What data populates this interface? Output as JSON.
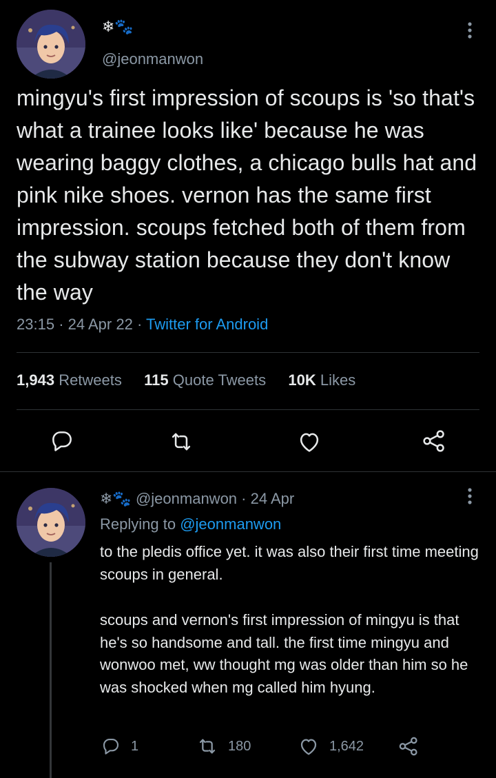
{
  "tweet": {
    "author_emoji": "❄🐾",
    "handle": "@jeonmanwon",
    "text": "mingyu's first impression of scoups is 'so that's what a trainee looks like' because he was wearing baggy clothes, a chicago bulls hat and pink nike shoes. vernon has the same first impression. scoups fetched both of them from the subway station because they don't know the way",
    "time": "23:15",
    "date": "24 Apr 22",
    "source": "Twitter for Android",
    "retweets_count": "1,943",
    "retweets_label": "Retweets",
    "quotes_count": "115",
    "quotes_label": "Quote Tweets",
    "likes_count": "10K",
    "likes_label": "Likes"
  },
  "reply": {
    "author_emoji": "❄🐾",
    "handle": "@jeonmanwon",
    "date": "24 Apr",
    "replying_label": "Replying to",
    "replying_handle": "@jeonmanwon",
    "paragraph1": "to the pledis office yet. it was also their first time meeting scoups in general.",
    "paragraph2": "scoups and vernon's first impression of mingyu is that he's so handsome and tall. the first time mingyu and wonwoo met, ww thought mg was older than him so he was shocked when mg called him hyung.",
    "reply_count": "1",
    "retweet_count": "180",
    "like_count": "1,642"
  },
  "icons": {
    "reply": "reply-icon",
    "retweet": "retweet-icon",
    "like": "heart-icon",
    "share": "share-icon",
    "more": "more-icon"
  },
  "colors": {
    "background": "#000000",
    "text": "#e7e9ea",
    "secondary": "#8b98a5",
    "link": "#1d9bf0",
    "divider": "#2f3336"
  }
}
